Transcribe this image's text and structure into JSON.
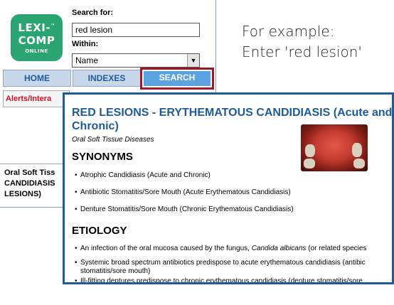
{
  "logo": {
    "line1": "LEXI-",
    "tm": "™",
    "line2": "COMP",
    "line3": "ONLINE"
  },
  "search": {
    "label": "Search for:",
    "value": "red lesion",
    "within_label": "Within:",
    "within_value": "Name"
  },
  "nav": {
    "home": "HOME",
    "indexes": "INDEXES",
    "search": "SEARCH"
  },
  "tabs": {
    "alerts": "Alerts/Intera"
  },
  "result_snippet": [
    "Oral Soft Tiss",
    "CANDIDIASIS",
    "LESIONS)"
  ],
  "caption": {
    "line1": "For example:",
    "line2": "Enter 'red lesion'"
  },
  "doc": {
    "title_line1": "RED LESIONS - ERYTHEMATOUS CANDIDIASIS (Acute and",
    "title_line2": "Chronic)",
    "subtitle": "Oral Soft Tissue Diseases",
    "synonyms_heading": "SYNONYMS",
    "synonyms": [
      "Atrophic Candidiasis (Acute and Chronic)",
      "Antibiotic Stomatitis/Sore Mouth (Acute Erythematous Candidiasis)",
      "Denture Stomatitis/Sore Mouth (Chronic Erythematous Candidiasis)"
    ],
    "etiology_heading": "ETIOLOGY",
    "etiology_1_pre": "An infection of the oral mucosa caused by the fungus, ",
    "etiology_1_em": "Candida albicans",
    "etiology_1_post": " (or related species",
    "etiology_2": "Systemic broad spectrum antibiotics predispose to acute erythematous candidiasis (antibic stomatitis/sore mouth)",
    "etiology_3": "Ill-fitting dentures predispose to chronic erythematous candidiasis (denture stomatitis/sore mouth)"
  },
  "colors": {
    "logo": "#2aa572",
    "accent_blue": "#1f5a9b",
    "highlight_red": "#a3172b"
  }
}
